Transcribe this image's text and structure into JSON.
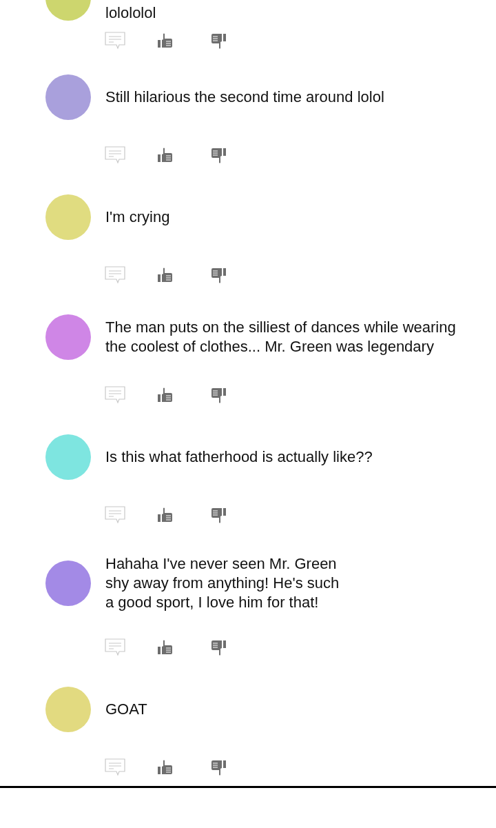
{
  "comments": [
    {
      "text": "lolololol",
      "color": "#cdd66e"
    },
    {
      "text": "Still hilarious the second time around lolol",
      "color": "#a9a0dc"
    },
    {
      "text": "I'm crying",
      "color": "#e0dc80"
    },
    {
      "text": "The man puts on the silliest of dances while wearing\nthe coolest of clothes... Mr. Green was legendary",
      "color": "#cf86e6"
    },
    {
      "text": "Is this what fatherhood is actually like??",
      "color": "#7ee5e0"
    },
    {
      "text": "Hahaha I've never seen Mr. Green\nshy away from anything! He's such\na good sport, I love him for that!",
      "color": "#a38ae6"
    },
    {
      "text": "GOAT",
      "color": "#e2da80"
    }
  ]
}
